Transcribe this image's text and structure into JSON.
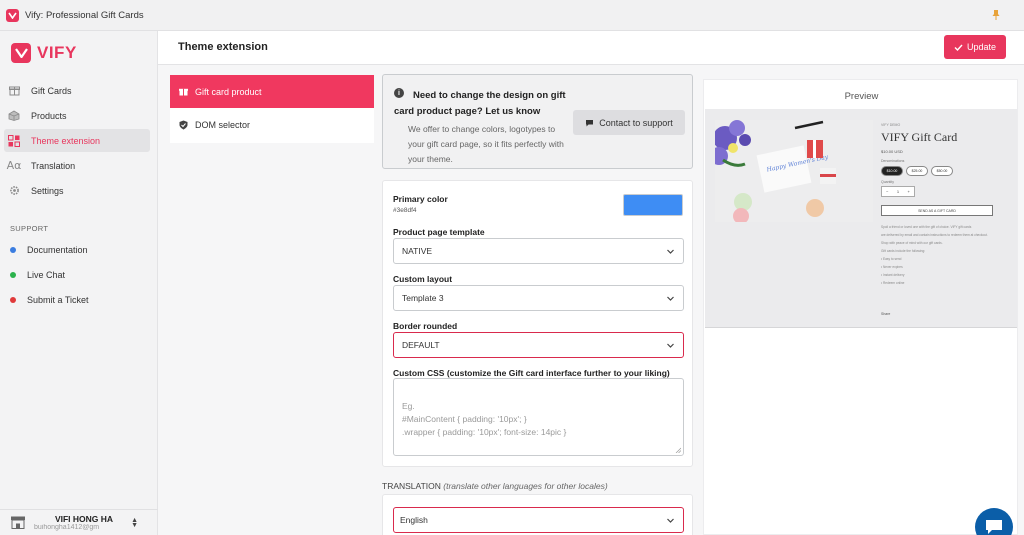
{
  "window": {
    "title": "Vify: Professional Gift Cards"
  },
  "brand": {
    "name": "VIFY",
    "color": "#e8365d"
  },
  "sidebar": {
    "items": [
      {
        "label": "Gift Cards",
        "icon": "gift-card-icon"
      },
      {
        "label": "Products",
        "icon": "products-icon"
      },
      {
        "label": "Theme extension",
        "icon": "theme-icon",
        "active": true
      },
      {
        "label": "Translation",
        "icon": "translation-icon"
      },
      {
        "label": "Settings",
        "icon": "settings-icon"
      }
    ],
    "support_title": "SUPPORT",
    "support_items": [
      {
        "label": "Documentation",
        "color": "#3b7de0"
      },
      {
        "label": "Live Chat",
        "color": "#2bb24c"
      },
      {
        "label": "Submit a Ticket",
        "color": "#e03a3a"
      }
    ],
    "account": {
      "name": "VIFI HONG HA",
      "email": "buihongha1412@gm"
    }
  },
  "header": {
    "title": "Theme extension",
    "update_label": "Update"
  },
  "tabs": [
    {
      "label": "Gift card product",
      "icon": "gift-icon",
      "active": true
    },
    {
      "label": "DOM selector",
      "icon": "shield-check-icon"
    }
  ],
  "notice": {
    "title": "Need to change the design on gift card product page? Let us know",
    "body": "We offer to change colors, logotypes to your gift card page, so it fits perfectly with your theme.",
    "contact_label": "Contact to support"
  },
  "form": {
    "primary_color_label": "Primary color",
    "primary_color_value": "#3e8df4",
    "template_label": "Product page template",
    "template_value": "NATIVE",
    "layout_label": "Custom layout",
    "layout_value": "Template 3",
    "border_label": "Border rounded",
    "border_value": "DEFAULT",
    "css_label": "Custom CSS (customize the Gift card interface further to your liking)",
    "css_placeholder": "Eg.\n#MainContent { padding: '10px'; }\n.wrapper { padding: '10px'; font-size: 14pic }"
  },
  "translation": {
    "label": "TRANSLATION",
    "hint": "(translate other languages for other locales)",
    "value": "English"
  },
  "preview": {
    "title": "Preview",
    "mock": {
      "brand": "VIFY DEMO",
      "product_title": "VIFY Gift Card",
      "price": "$10.00 USD",
      "denomination_label": "Denominations",
      "denominations": [
        "$10.00",
        "$25.00",
        "$50.00"
      ],
      "quantity_label": "Quantity",
      "quantity": "1",
      "send_label": "SEND AS A GIFT CARD",
      "card_text": "Happy Women's Day",
      "description_lines": [
        "Spoil a friend or loved one with the gift of choice. VIFY gift cards",
        "are delivered by email and contain instructions to redeem them at checkout.",
        "Shop with peace of mind with our gift cards.",
        "Gift cards include the following:",
        "• Easy to send",
        "• Never expires",
        "• Instant delivery",
        "• Redeem online"
      ],
      "share_label": "Share"
    }
  }
}
